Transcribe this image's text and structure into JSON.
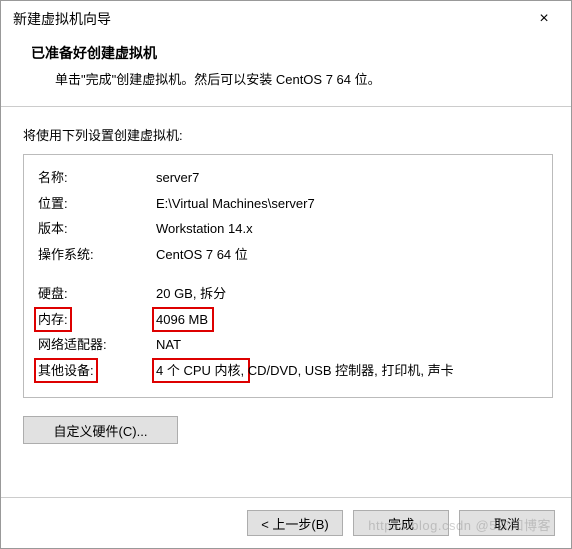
{
  "titlebar": {
    "title": "新建虚拟机向导",
    "close_label": "×"
  },
  "header": {
    "title": "已准备好创建虚拟机",
    "subtitle": "单击\"完成\"创建虚拟机。然后可以安装 CentOS 7 64 位。"
  },
  "body": {
    "intro": "将使用下列设置创建虚拟机:"
  },
  "settings": {
    "rows": [
      {
        "label": "名称:",
        "value": "server7"
      },
      {
        "label": "位置:",
        "value": "E:\\Virtual Machines\\server7"
      },
      {
        "label": "版本:",
        "value": "Workstation 14.x"
      },
      {
        "label": "操作系统:",
        "value": "CentOS 7 64 位"
      }
    ],
    "rows2": [
      {
        "label": "硬盘:",
        "value": "20 GB, 拆分"
      },
      {
        "label": "内存:",
        "value": "4096 MB",
        "hl_label": true,
        "hl_value": true
      },
      {
        "label": "网络适配器:",
        "value": "NAT"
      },
      {
        "label": "其他设备:",
        "hl_label": true,
        "hl_value_part": "4 个 CPU 内核,",
        "value_rest": " CD/DVD, USB 控制器, 打印机, 声卡"
      }
    ]
  },
  "buttons": {
    "customize": "自定义硬件(C)...",
    "back": "< 上一步(B)",
    "finish": "完成",
    "cancel": "取消"
  },
  "watermark": "https://blog.csdn @5次知博客"
}
